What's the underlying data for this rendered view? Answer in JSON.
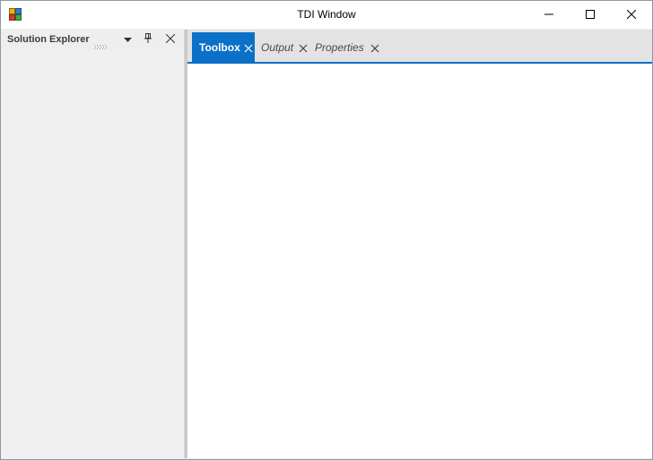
{
  "window": {
    "title": "TDI Window",
    "icons": {
      "app": "app-icon",
      "minimize": "minimize-icon",
      "maximize": "maximize-icon",
      "close": "close-icon"
    }
  },
  "solution_explorer": {
    "title": "Solution Explorer",
    "icons": [
      "grip-icon",
      "chevron-down-icon",
      "pin-icon",
      "close-icon"
    ]
  },
  "document_tabs": [
    {
      "label": "Toolbox",
      "active": true
    },
    {
      "label": "Output",
      "active": false
    },
    {
      "label": "Properties",
      "active": false
    }
  ],
  "colors": {
    "accent": "#0b71c8",
    "tab_strip": "#e3e3e3",
    "pane_bg": "#f0f0f0"
  }
}
